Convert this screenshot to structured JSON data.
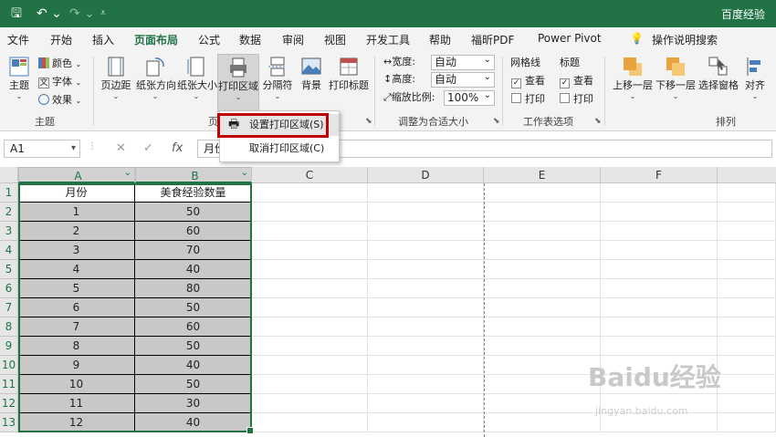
{
  "titlebar": {
    "app_title": "百度经验"
  },
  "tabs": [
    "文件",
    "开始",
    "插入",
    "页面布局",
    "公式",
    "数据",
    "审阅",
    "视图",
    "开发工具",
    "帮助",
    "福昕PDF",
    "Power Pivot"
  ],
  "active_tab": "页面布局",
  "tell_me": "操作说明搜索",
  "ribbon": {
    "themes": {
      "theme": "主题",
      "colors": "颜色",
      "fonts": "字体",
      "effects": "效果",
      "group": "主题"
    },
    "page_setup": {
      "margins": "页边距",
      "orientation": "纸张方向",
      "size": "纸张大小",
      "print_area": "打印区域",
      "breaks": "分隔符",
      "background": "背景",
      "print_titles": "打印标题",
      "group_partial": "页"
    },
    "scale": {
      "width_label": "宽度:",
      "width_value": "自动",
      "height_label": "高度:",
      "height_value": "自动",
      "scale_label": "缩放比例:",
      "scale_value": "100%",
      "group": "调整为合适大小"
    },
    "sheet_options": {
      "gridlines": "网格线",
      "headings": "标题",
      "view": "查看",
      "print": "打印",
      "group": "工作表选项"
    },
    "arrange": {
      "bring_forward": "上移一层",
      "send_backward": "下移一层",
      "selection_pane": "选择窗格",
      "align": "对齐",
      "group": "排列"
    }
  },
  "print_area_menu": {
    "set": "设置打印区域(S)",
    "clear": "取消打印区域(C)"
  },
  "formula_bar": {
    "name_box": "A1",
    "content": "月份"
  },
  "sheet": {
    "columns": [
      "A",
      "B",
      "C",
      "D",
      "E",
      "F"
    ],
    "row_numbers": [
      "1",
      "2",
      "3",
      "4",
      "5",
      "6",
      "7",
      "8",
      "9",
      "10",
      "11",
      "12",
      "13"
    ],
    "header": [
      "月份",
      "美食经验数量"
    ],
    "rows": [
      [
        "1",
        "50"
      ],
      [
        "2",
        "60"
      ],
      [
        "3",
        "70"
      ],
      [
        "4",
        "40"
      ],
      [
        "5",
        "80"
      ],
      [
        "6",
        "50"
      ],
      [
        "7",
        "60"
      ],
      [
        "8",
        "50"
      ],
      [
        "9",
        "40"
      ],
      [
        "10",
        "50"
      ],
      [
        "11",
        "30"
      ],
      [
        "12",
        "40"
      ]
    ]
  },
  "watermark": {
    "text": "Baidu经验",
    "url": "jingyan.baidu.com"
  },
  "colors": {
    "accent": "#217346",
    "highlight": "#c00000",
    "data_fill": "#c8c8c8"
  }
}
